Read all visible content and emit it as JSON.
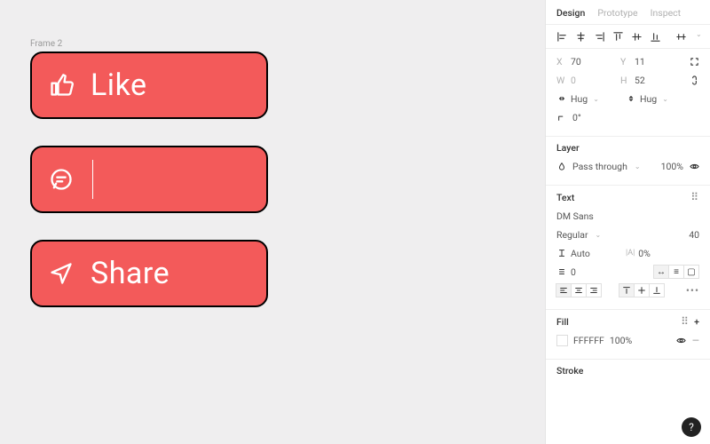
{
  "canvas": {
    "frame_label": "Frame 2",
    "cards": [
      {
        "name": "like-card",
        "icon": "thumbs-up-icon",
        "label": "Like"
      },
      {
        "name": "comment-card",
        "icon": "chat-icon",
        "label": ""
      },
      {
        "name": "share-card",
        "icon": "paper-plane-icon",
        "label": "Share"
      }
    ]
  },
  "panel": {
    "tabs": {
      "design": "Design",
      "prototype": "Prototype",
      "inspect": "Inspect"
    },
    "frame": {
      "x_label": "X",
      "x": "70",
      "y_label": "Y",
      "y": "11",
      "w_label": "W",
      "w": "0",
      "h_label": "H",
      "h": "52",
      "resize_h": "Hug",
      "resize_v": "Hug",
      "rotation": "0°"
    },
    "layer": {
      "title": "Layer",
      "blend": "Pass through",
      "opacity": "100%"
    },
    "text": {
      "title": "Text",
      "font": "DM Sans",
      "weight": "Regular",
      "size": "40",
      "line_height": "Auto",
      "letter_spacing": "0%",
      "paragraph_spacing": "0"
    },
    "fill": {
      "title": "Fill",
      "hex": "FFFFFF",
      "opacity": "100%"
    },
    "stroke_title": "Stroke",
    "help": "?"
  }
}
